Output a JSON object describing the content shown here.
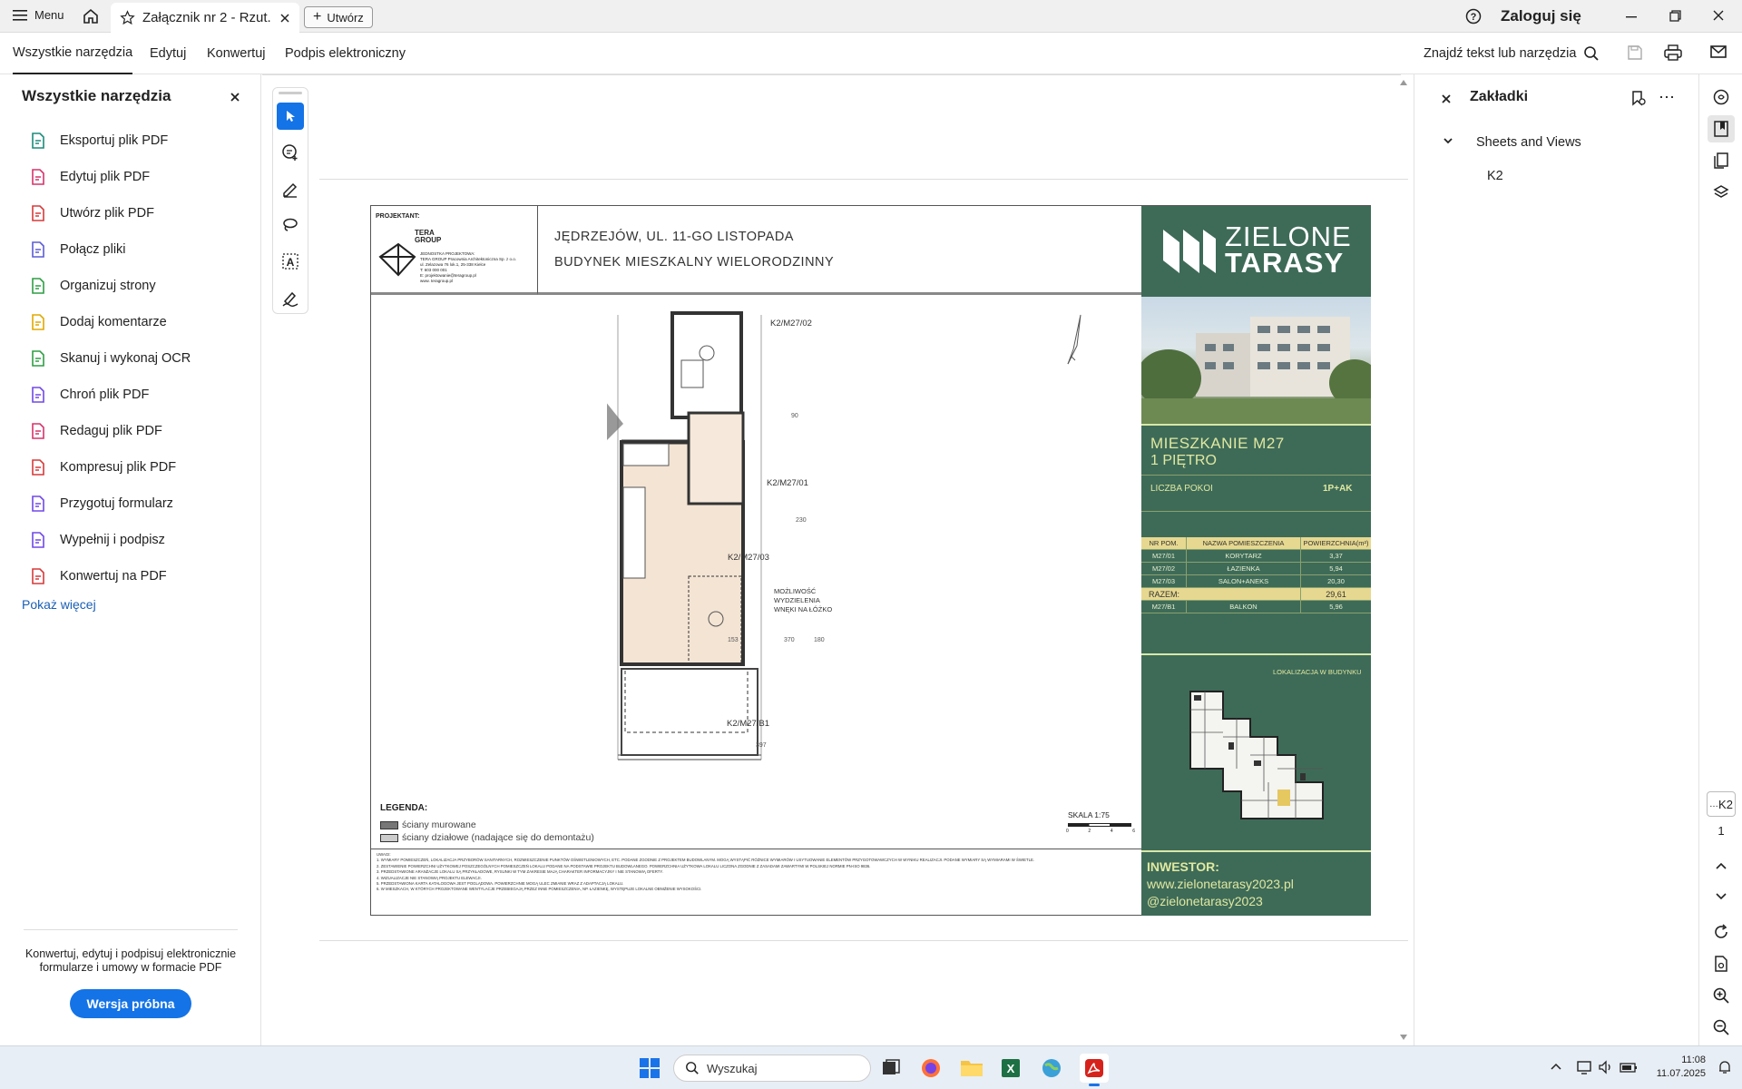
{
  "titlebar": {
    "menu_label": "Menu",
    "tab_title": "Załącznik nr 2 - Rzut...",
    "new_label": "Utwórz",
    "signin_label": "Zaloguj się"
  },
  "menubar": {
    "items": [
      "Wszystkie narzędzia",
      "Edytuj",
      "Konwertuj",
      "Podpis elektroniczny"
    ],
    "search_label": "Znajdź tekst lub narzędzia"
  },
  "left_panel": {
    "title": "Wszystkie narzędzia",
    "tools": [
      {
        "label": "Eksportuj plik PDF",
        "color": "#1a8c7a"
      },
      {
        "label": "Edytuj plik PDF",
        "color": "#d6336c"
      },
      {
        "label": "Utwórz plik PDF",
        "color": "#d63a3a"
      },
      {
        "label": "Połącz pliki",
        "color": "#5b5bd6"
      },
      {
        "label": "Organizuj strony",
        "color": "#2f9e44"
      },
      {
        "label": "Dodaj komentarze",
        "color": "#e0a800"
      },
      {
        "label": "Skanuj i wykonaj OCR",
        "color": "#2f9e44"
      },
      {
        "label": "Chroń plik PDF",
        "color": "#7048e8"
      },
      {
        "label": "Redaguj plik PDF",
        "color": "#d6336c"
      },
      {
        "label": "Kompresuj plik PDF",
        "color": "#d63a3a"
      },
      {
        "label": "Przygotuj formularz",
        "color": "#7048e8"
      },
      {
        "label": "Wypełnij i podpisz",
        "color": "#7048e8"
      },
      {
        "label": "Konwertuj na PDF",
        "color": "#d63a3a"
      }
    ],
    "show_more": "Pokaż więcej",
    "promo_text": "Konwertuj, edytuj i podpisuj elektronicznie formularze i umowy w formacie PDF",
    "trial_button": "Wersja próbna"
  },
  "right_panel": {
    "title": "Zakładki",
    "tree_root": "Sheets and Views",
    "tree_child": "K2"
  },
  "page_nav": {
    "page_label": "K2",
    "page_number": "1"
  },
  "document": {
    "projektant_label": "PROJEKTANT:",
    "firm_name": "TERA GROUP",
    "firm_lines": [
      "JEDNOSTKA PROJEKTOWA:",
      "TERA GROUP Pracownia Architektoniczna Sp. z o.o.",
      "ul. Zelazowa 76 lok.1, 25-338 Kielce",
      "T: 603 000 001",
      "E: projektowanie@teragroup.pl",
      "www. teragroup.pl"
    ],
    "address_line1": "JĘDRZEJÓW, UL. 11-GO LISTOPADA",
    "address_line2": "BUDYNEK MIESZKALNY WIELORODZINNY",
    "brand_top": "ZIELONE",
    "brand_bottom": "TARASY",
    "apartment_title": "MIESZKANIE M27",
    "floor": "1 PIĘTRO",
    "rooms_label": "LICZBA POKOI",
    "rooms_value": "1P+AK",
    "table_headers": [
      "NR POM.",
      "NAZWA POMIESZCZENIA",
      "POWIERZCHNIA(m²)"
    ],
    "table_rows": [
      [
        "M27/01",
        "KORYTARZ",
        "3,37"
      ],
      [
        "M27/02",
        "ŁAZIENKA",
        "5,94"
      ],
      [
        "M27/03",
        "SALON+ANEKS",
        "20,30"
      ]
    ],
    "total_label": "RAZEM:",
    "total_value": "29,61",
    "balcony_row": [
      "M27/B1",
      "BALKON",
      "5,96"
    ],
    "location_label": "LOKALIZACJA W BUDYNKU",
    "investor_label": "INWESTOR:",
    "investor_web": "www.zielonetarasy2023.pl",
    "investor_social": "@zielonetarasy2023",
    "room_labels": [
      "K2/M27/02",
      "K2/M27/01",
      "K2/M27/03",
      "K2/M27/B1"
    ],
    "bath_note": [
      "MOŻLIWOŚĆ",
      "WYDZIELENIA",
      "WNĘKI NA ŁÓŻKO"
    ],
    "legend_title": "LEGENDA:",
    "legend_items": [
      "ściany murowane",
      "ściany działowe (nadające się do demontażu)"
    ],
    "scale_label": "SKALA 1:75",
    "scale_ticks": [
      "0",
      "2",
      "4",
      "6"
    ],
    "dims": [
      "90",
      "230",
      "153",
      "370",
      "397",
      "180"
    ],
    "notes_title": "UWAGI:",
    "notes": [
      "1. WYMIARY POMIESZCZEŃ, LOKALIZACJA PRZYBORÓW SANITARNYCH, ROZMIESZCZENIE PUNKTÓW OŚWIETLENIOWYCH, ETC. PODANE ZGODNIE Z PROJEKTEM BUDOWLANYM. MOGĄ WYSTĄPIĆ RÓŻNICE WYMIARÓW I USYTUOWANIE ELEMENTÓW PRZYGOTOWAWCZYCH W WYNIKU REALIZACJI. PODANE WYMIARY SĄ WYMIARAMI W ŚWIETLE.",
      "2. ZESTAWIENIE POWIERZCHNI UŻYTKOWEJ POSZCZEGÓLNYCH POMIESZCZEŃ LOKALU PODANE NA PODSTAWIE PROJEKTU BUDOWLANEGO. POWIERZCHNIA UŻYTKOWA LOKALU LICZONA ZGODNIE Z ZASADAMI ZAWARTYMI W POLSKIEJ NORMIE PN-ISO 9836.",
      "3. PRZEDSTAWIONE ARANŻACJE LOKALU SĄ PRZYKŁADOWE, RYSUNKI W TYM ZAKRESIE MAJĄ CHARAKTER INFORMACYJNY I NIE STANOWIĄ OFERTY.",
      "4. WIZUALIZACJE NIE STANOWIĄ PROJEKTU ELEWACJI.",
      "5. PRZEDSTAWIONA KARTA KATALOGOWA JEST POGLĄDOWA. POWIERZCHNIE MOGĄ ULEC ZMIANIE WRAZ Z ADAPTACJĄ LOKALU.",
      "6. W MIESZKACH, W KTÓRYCH PROJEKTOWANE WENTYLACJE PRZEBIEGAJĄ PRZEZ INNE POMIESZCZENIA, NP. ŁAZIENKĘ, WYSTĘPUJE LOKALNE OBNIŻENIE WYSOKOŚCI."
    ]
  },
  "taskbar": {
    "search_label": "Wyszukaj",
    "time": "11:08",
    "date": "11.07.2025"
  },
  "colors": {
    "brand_green": "#3e6b58",
    "accent_blue": "#1473e6",
    "table_highlight": "#e6d890"
  }
}
